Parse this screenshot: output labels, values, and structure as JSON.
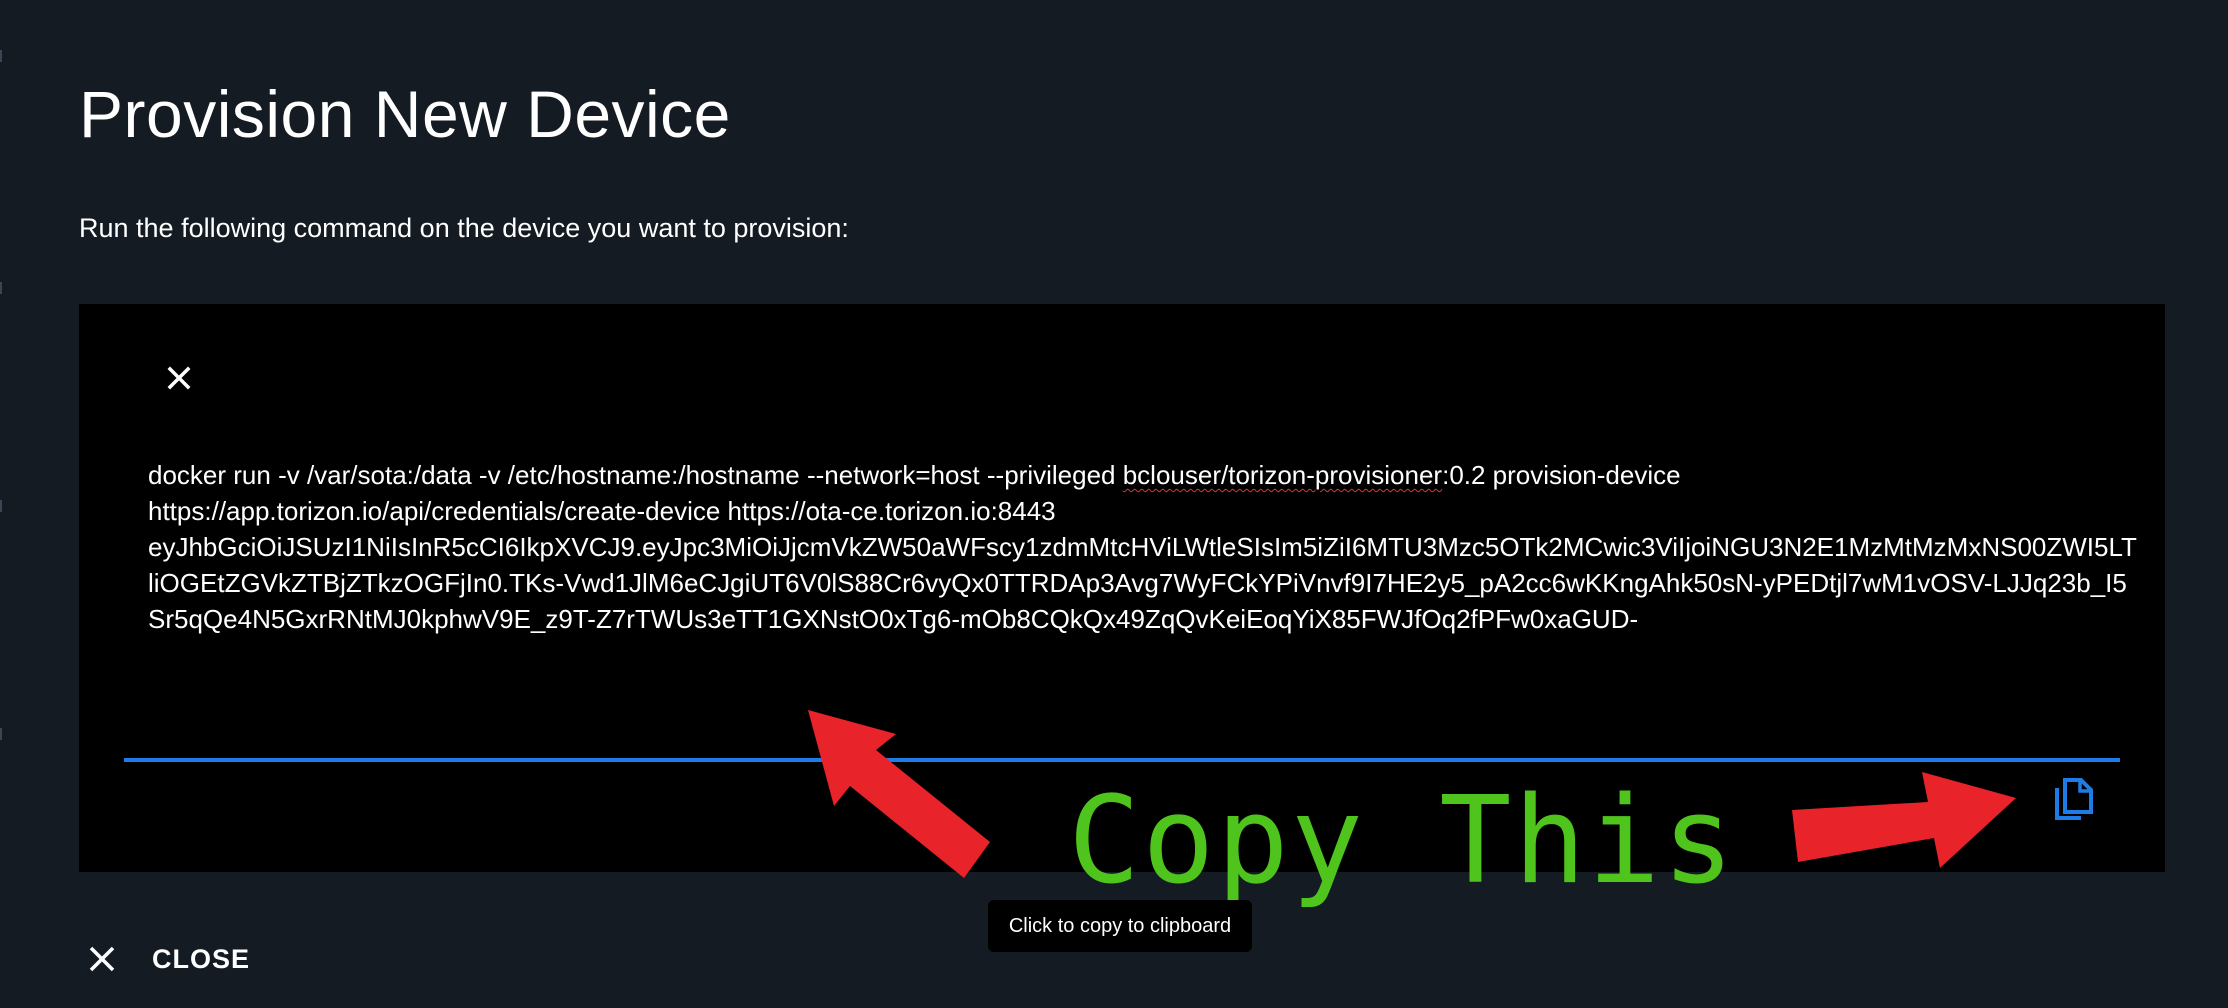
{
  "dialog": {
    "title": "Provision New Device",
    "instruction": "Run the following command on the device you want to provision:"
  },
  "command": {
    "part1": "docker run -v /var/sota:/data -v /etc/hostname:/hostname --network=host --privileged ",
    "part2": "bclouser/torizon-provisioner",
    "part3": ":0.2 provision-device\nhttps://app.torizon.io/api/credentials/create-device https://ota-ce.torizon.io:8443\neyJhbGciOiJSUzI1NiIsInR5cCI6IkpXVCJ9.eyJpc3MiOiJjcmVkZW50aWFscy1zdmMtcHViLWtleSIsIm5iZiI6MTU3Mzc5OTk2MCwic3ViIjoiNGU3N2E1MzMtMzMxNS00ZWI5LTliOGEtZGVkZTBjZTkzOGFjIn0.TKs-Vwd1JlM6eCJgiUT6V0lS88Cr6vyQx0TTRDAp3Avg7WyFCkYPiVnvf9I7HE2y5_pA2cc6wKKngAhk50sN-yPEDtjl7wM1vOSV-LJJq23b_I5Sr5qQe4N5GxrRNtMJ0kphwV9E_z9T-Z7rTWUs3eTT1GXNstO0xTg6-mOb8CQkQx49ZqQvKeiEoqYiX85FWJfOq2fPFw0xaGUD-"
  },
  "annotation": {
    "text": "Copy This"
  },
  "tooltip": {
    "text": "Click to copy to clipboard"
  },
  "actions": {
    "close_label": "CLOSE"
  },
  "icons": {
    "clear": "close-icon",
    "copy": "copy-icon",
    "close": "close-icon"
  },
  "colors": {
    "background": "#141b23",
    "command_box": "#000000",
    "accent_blue": "#1e7ce8",
    "annotation_green": "#4fc41c",
    "arrow_red": "#e8232a"
  }
}
